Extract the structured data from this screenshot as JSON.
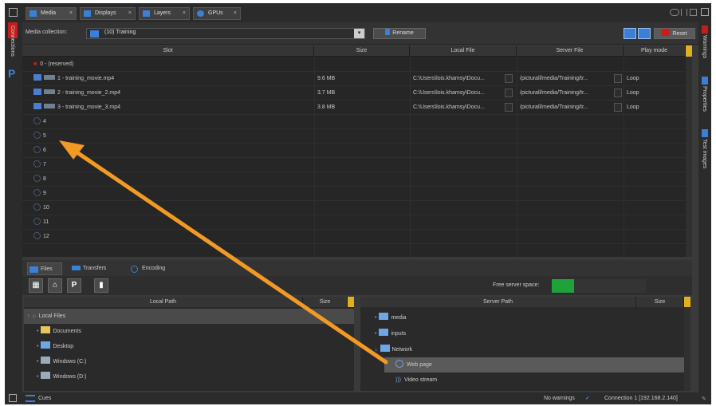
{
  "left_strip": {
    "label": "Connections",
    "p_logo": "P"
  },
  "right_strip": {
    "labels": [
      "Warnings",
      "Properties",
      "Test images"
    ]
  },
  "tabs": [
    {
      "label": "Media",
      "close": "×"
    },
    {
      "label": "Displays",
      "close": "×"
    },
    {
      "label": "Layers",
      "close": "×"
    },
    {
      "label": "GPUs",
      "close": "×"
    }
  ],
  "toolbar": {
    "collection_label": "Media collection:",
    "collection_value": "(10) Training",
    "rename_label": "Rename",
    "reset_label": "Reset"
  },
  "media_table": {
    "columns": [
      "Slot",
      "Size",
      "Local File",
      "Server File",
      "Play mode"
    ],
    "rows": [
      {
        "slot": "0 - (reserved)",
        "size": "",
        "local": "",
        "server": "",
        "mode": "",
        "type": "reserved"
      },
      {
        "slot": "1 - training_movie.mp4",
        "size": "9.6 MB",
        "local": "C:\\Users\\lois.khamsy\\Docu...",
        "server": "/picturall/media/Training/tr...",
        "mode": "Loop",
        "type": "file"
      },
      {
        "slot": "2 - training_movie_2.mp4",
        "size": "3.7 MB",
        "local": "C:\\Users\\lois.khamsy\\Docu...",
        "server": "/picturall/media/Training/tr...",
        "mode": "Loop",
        "type": "file"
      },
      {
        "slot": "3 - training_movie_3.mp4",
        "size": "3.8 MB",
        "local": "C:\\Users\\lois.khamsy\\Docu...",
        "server": "/picturall/media/Training/tr...",
        "mode": "Loop",
        "type": "file"
      },
      {
        "slot": "4",
        "type": "empty"
      },
      {
        "slot": "5",
        "type": "empty"
      },
      {
        "slot": "6",
        "type": "empty"
      },
      {
        "slot": "7",
        "type": "empty"
      },
      {
        "slot": "8",
        "type": "empty"
      },
      {
        "slot": "9",
        "type": "empty"
      },
      {
        "slot": "10",
        "type": "empty"
      },
      {
        "slot": "11",
        "type": "empty"
      },
      {
        "slot": "12",
        "type": "empty"
      }
    ]
  },
  "bottom_tabs": [
    "Files",
    "Transfers",
    "Encoding"
  ],
  "file_toolbar": {
    "icons": [
      "drive-icon",
      "home-icon",
      "picturall-icon",
      "trash-icon"
    ],
    "free_space_label": "Free server space:"
  },
  "local_panel": {
    "columns": [
      "Local Path",
      "Size"
    ],
    "items": [
      {
        "label": "Local Files",
        "selected": true
      },
      {
        "label": "Documents"
      },
      {
        "label": "Desktop"
      },
      {
        "label": "Windows (C:)"
      },
      {
        "label": "Windows (D:)"
      }
    ]
  },
  "server_panel": {
    "columns": [
      "Server Path",
      "Size"
    ],
    "items": [
      {
        "label": "media"
      },
      {
        "label": "inputs"
      },
      {
        "label": "Network"
      },
      {
        "label": "Web page",
        "selected": true
      },
      {
        "label": "Video stream"
      }
    ]
  },
  "status": {
    "cues_label": "Cues",
    "warnings": "No warnings",
    "connection": "Connection 1 [192.168.2.140]"
  },
  "colors": {
    "arrow": "#f39a25",
    "accent": "#3b7fd6",
    "reset": "#c81d1d",
    "free_space": "#1ea33a"
  }
}
